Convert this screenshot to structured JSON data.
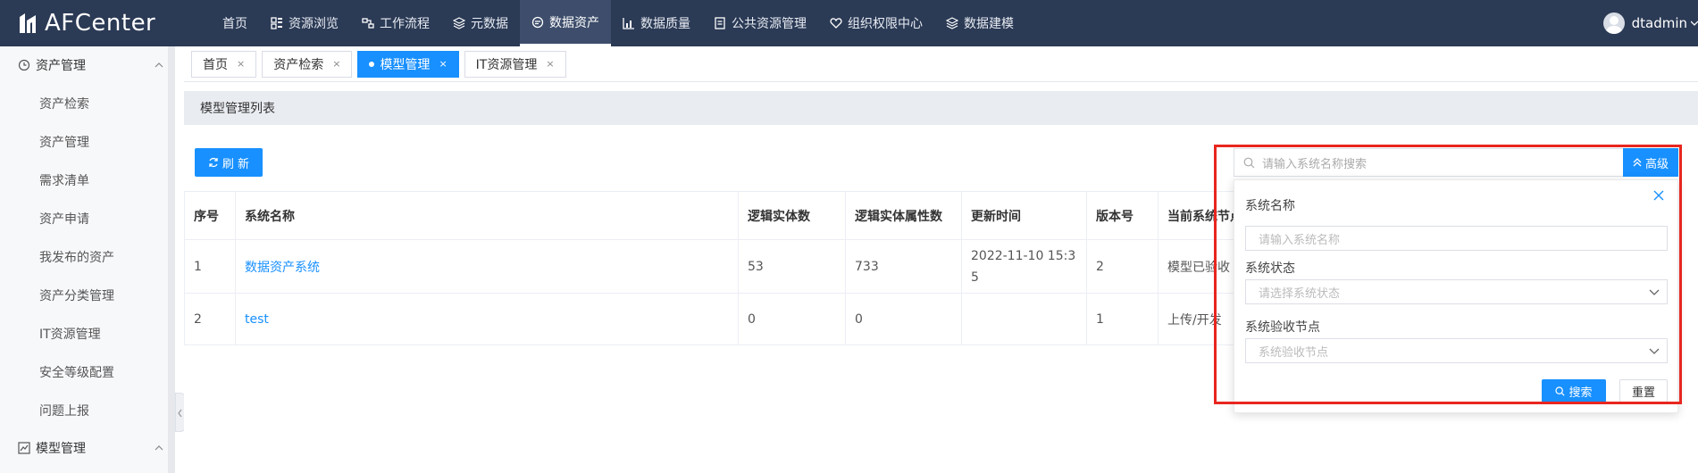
{
  "app": {
    "logo_text": "AFCenter",
    "user_name": "dtadmin"
  },
  "nav": {
    "items": [
      {
        "label": "首页",
        "icon": "",
        "active": false
      },
      {
        "label": "资源浏览",
        "icon": "grid-icon",
        "active": false
      },
      {
        "label": "工作流程",
        "icon": "workflow-icon",
        "active": false
      },
      {
        "label": "元数据",
        "icon": "layers-icon",
        "active": false
      },
      {
        "label": "数据资产",
        "icon": "asset-icon",
        "active": true
      },
      {
        "label": "数据质量",
        "icon": "chart-icon",
        "active": false
      },
      {
        "label": "公共资源管理",
        "icon": "folder-icon",
        "active": false
      },
      {
        "label": "组织权限中心",
        "icon": "heart-icon",
        "active": false
      },
      {
        "label": "数据建模",
        "icon": "cube-icon",
        "active": false
      }
    ]
  },
  "sidebar": {
    "group1": "资产管理",
    "items": [
      "资产检索",
      "资产管理",
      "需求清单",
      "资产申请",
      "我发布的资产",
      "资产分类管理",
      "IT资源管理",
      "安全等级配置",
      "问题上报"
    ],
    "group2": "模型管理"
  },
  "tabs": [
    {
      "label": "首页",
      "active": false
    },
    {
      "label": "资产检索",
      "active": false
    },
    {
      "label": "模型管理",
      "active": true
    },
    {
      "label": "IT资源管理",
      "active": false
    }
  ],
  "tab_close": "×",
  "panel": {
    "title": "模型管理列表",
    "refresh_label": "刷 新"
  },
  "search": {
    "placeholder": "请输入系统名称搜索",
    "advanced_label": "高级"
  },
  "table": {
    "headers": [
      "序号",
      "系统名称",
      "逻辑实体数",
      "逻辑实体属性数",
      "更新时间",
      "版本号",
      "当前系统节点"
    ],
    "rows": [
      {
        "index": "1",
        "name": "数据资产系统",
        "entities": "53",
        "attributes": "733",
        "updated_line1": "2022-11-10 15:3",
        "updated_line2": "5",
        "version": "2",
        "node": "模型已验收"
      },
      {
        "index": "2",
        "name": "test",
        "entities": "0",
        "attributes": "0",
        "updated_line1": "",
        "updated_line2": "",
        "version": "1",
        "node": "上传/开发"
      }
    ]
  },
  "advanced": {
    "name_label": "系统名称",
    "name_placeholder": "请输入系统名称",
    "status_label": "系统状态",
    "status_placeholder": "请选择系统状态",
    "node_label": "系统验收节点",
    "node_placeholder": "系统验收节点",
    "search_label": "搜索",
    "reset_label": "重置"
  },
  "colors": {
    "topbar": "#2b3a55",
    "accent": "#1890ff",
    "highlight": "#e8261f"
  }
}
